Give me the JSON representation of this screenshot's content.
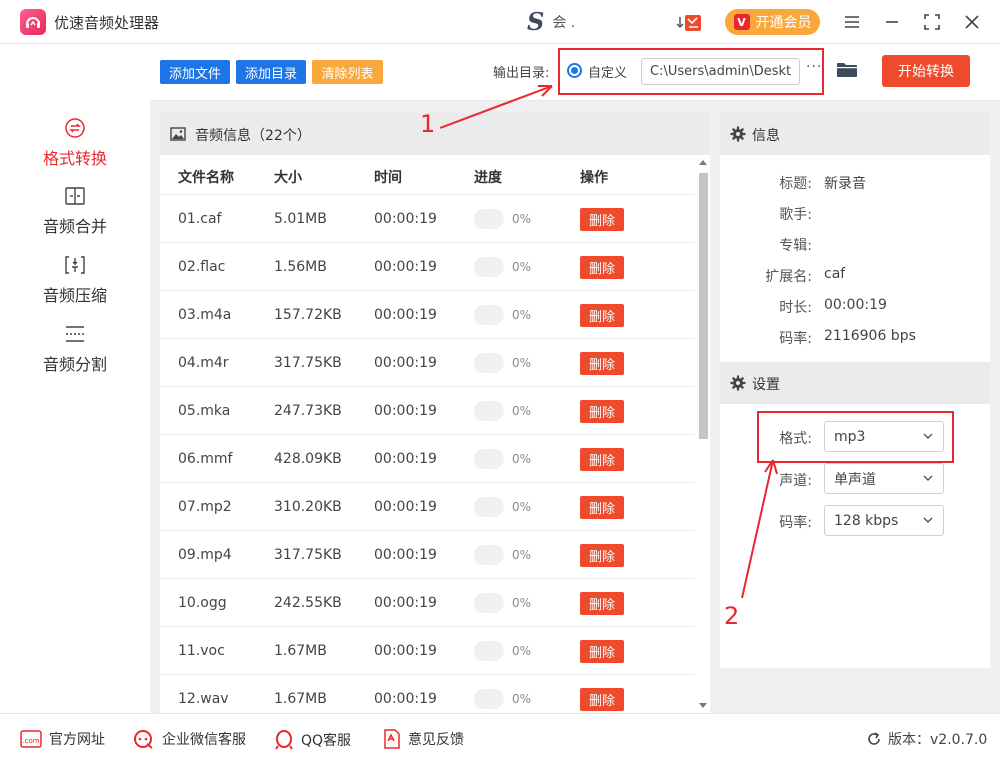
{
  "app": {
    "title": "优速音频处理器",
    "user_name": "会 .",
    "vip_label": "开通会员"
  },
  "sidebar": {
    "items": [
      {
        "label": "格式转换",
        "icon": "format-convert-icon"
      },
      {
        "label": "音频合并",
        "icon": "merge-icon"
      },
      {
        "label": "音频压缩",
        "icon": "compress-icon"
      },
      {
        "label": "音频分割",
        "icon": "split-icon"
      }
    ]
  },
  "toolbar": {
    "add_file": "添加文件",
    "add_dir": "添加目录",
    "clear_list": "清除列表",
    "output_label": "输出目录:",
    "custom_label": "自定义",
    "output_path": "C:\\Users\\admin\\Deskto",
    "more": "···",
    "start": "开始转换"
  },
  "file_list": {
    "title": "音频信息（22个）",
    "columns": [
      "文件名称",
      "大小",
      "时间",
      "进度",
      "操作"
    ],
    "delete_label": "删除",
    "rows": [
      {
        "name": "01.caf",
        "size": "5.01MB",
        "time": "00:00:19",
        "progress": "0%"
      },
      {
        "name": "02.flac",
        "size": "1.56MB",
        "time": "00:00:19",
        "progress": "0%"
      },
      {
        "name": "03.m4a",
        "size": "157.72KB",
        "time": "00:00:19",
        "progress": "0%"
      },
      {
        "name": "04.m4r",
        "size": "317.75KB",
        "time": "00:00:19",
        "progress": "0%"
      },
      {
        "name": "05.mka",
        "size": "247.73KB",
        "time": "00:00:19",
        "progress": "0%"
      },
      {
        "name": "06.mmf",
        "size": "428.09KB",
        "time": "00:00:19",
        "progress": "0%"
      },
      {
        "name": "07.mp2",
        "size": "310.20KB",
        "time": "00:00:19",
        "progress": "0%"
      },
      {
        "name": "09.mp4",
        "size": "317.75KB",
        "time": "00:00:19",
        "progress": "0%"
      },
      {
        "name": "10.ogg",
        "size": "242.55KB",
        "time": "00:00:19",
        "progress": "0%"
      },
      {
        "name": "11.voc",
        "size": "1.67MB",
        "time": "00:00:19",
        "progress": "0%"
      },
      {
        "name": "12.wav",
        "size": "1.67MB",
        "time": "00:00:19",
        "progress": "0%"
      }
    ]
  },
  "info": {
    "title": "信息",
    "fields": [
      {
        "label": "标题:",
        "value": "新录音"
      },
      {
        "label": "歌手:",
        "value": ""
      },
      {
        "label": "专辑:",
        "value": ""
      },
      {
        "label": "扩展名:",
        "value": "caf"
      },
      {
        "label": "时长:",
        "value": "00:00:19"
      },
      {
        "label": "码率:",
        "value": "2116906 bps"
      }
    ]
  },
  "settings": {
    "title": "设置",
    "format_label": "格式:",
    "format_value": "mp3",
    "channel_label": "声道:",
    "channel_value": "单声道",
    "bitrate_label": "码率:",
    "bitrate_value": "128 kbps"
  },
  "annotations": {
    "one": "1",
    "two": "2"
  },
  "footer": {
    "website": "官方网址",
    "wechat": "企业微信客服",
    "qq": "QQ客服",
    "feedback": "意见反馈",
    "version": "版本：v2.0.7.0"
  },
  "colors": {
    "accent_red": "#f04a2c",
    "blue": "#1e76e6",
    "orange": "#f9a93c",
    "active_text": "#e8282e"
  }
}
